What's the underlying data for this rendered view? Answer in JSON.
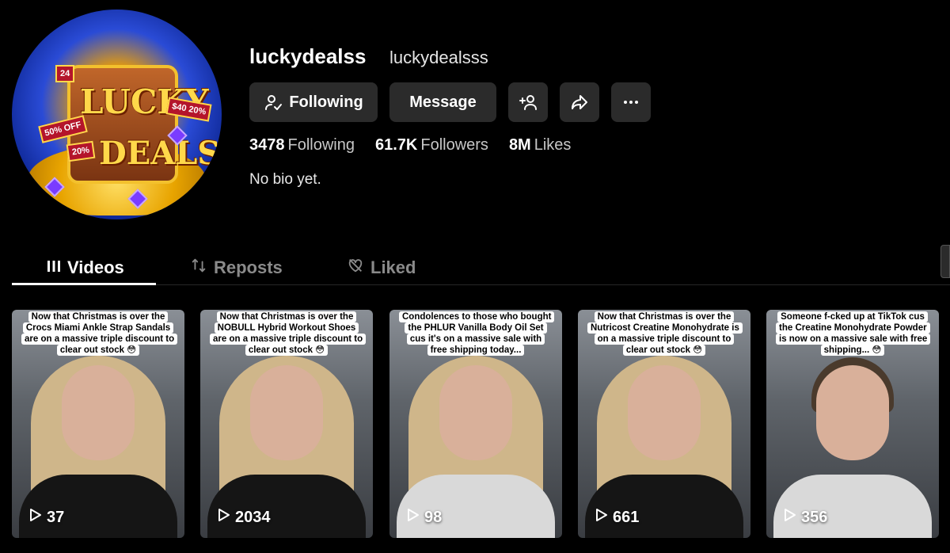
{
  "profile": {
    "username": "luckydealss",
    "nickname": "luckydealsss",
    "bio": "No bio yet.",
    "avatar_text": [
      "LUCKY",
      "DEALS",
      "50% OFF",
      "$40 20%",
      "20%",
      "24"
    ]
  },
  "actions": {
    "following_label": "Following",
    "message_label": "Message",
    "add_friend_icon": "add-user-icon",
    "share_icon": "share-icon",
    "more_icon": "more-icon"
  },
  "stats": [
    {
      "value": "3478",
      "label": "Following"
    },
    {
      "value": "61.7K",
      "label": "Followers"
    },
    {
      "value": "8M",
      "label": "Likes"
    }
  ],
  "tabs": [
    {
      "label": "Videos",
      "icon": "grid-icon",
      "active": true
    },
    {
      "label": "Reposts",
      "icon": "repost-icon",
      "active": false
    },
    {
      "label": "Liked",
      "icon": "liked-icon",
      "active": false
    }
  ],
  "videos": [
    {
      "caption": "Now that Christmas is over the Crocs Miami Ankle Strap Sandals are on a massive triple discount to clear out stock 😳",
      "plays": "37"
    },
    {
      "caption": "Now that Christmas is over the NOBULL Hybrid Workout Shoes are on a massive triple discount to clear out stock 😳",
      "plays": "2034"
    },
    {
      "caption": "Condolences to those who bought the PHLUR Vanilla Body Oil Set cus it's on a massive sale with free shipping today...",
      "plays": "98"
    },
    {
      "caption": "Now that Christmas is over the Nutricost Creatine Monohydrate is on a massive triple discount to clear out stock 😳",
      "plays": "661"
    },
    {
      "caption": "Someone f-cked up at TikTok cus the Creatine Monohydrate Powder is now on a massive sale with free shipping... 😳",
      "plays": "356"
    }
  ]
}
